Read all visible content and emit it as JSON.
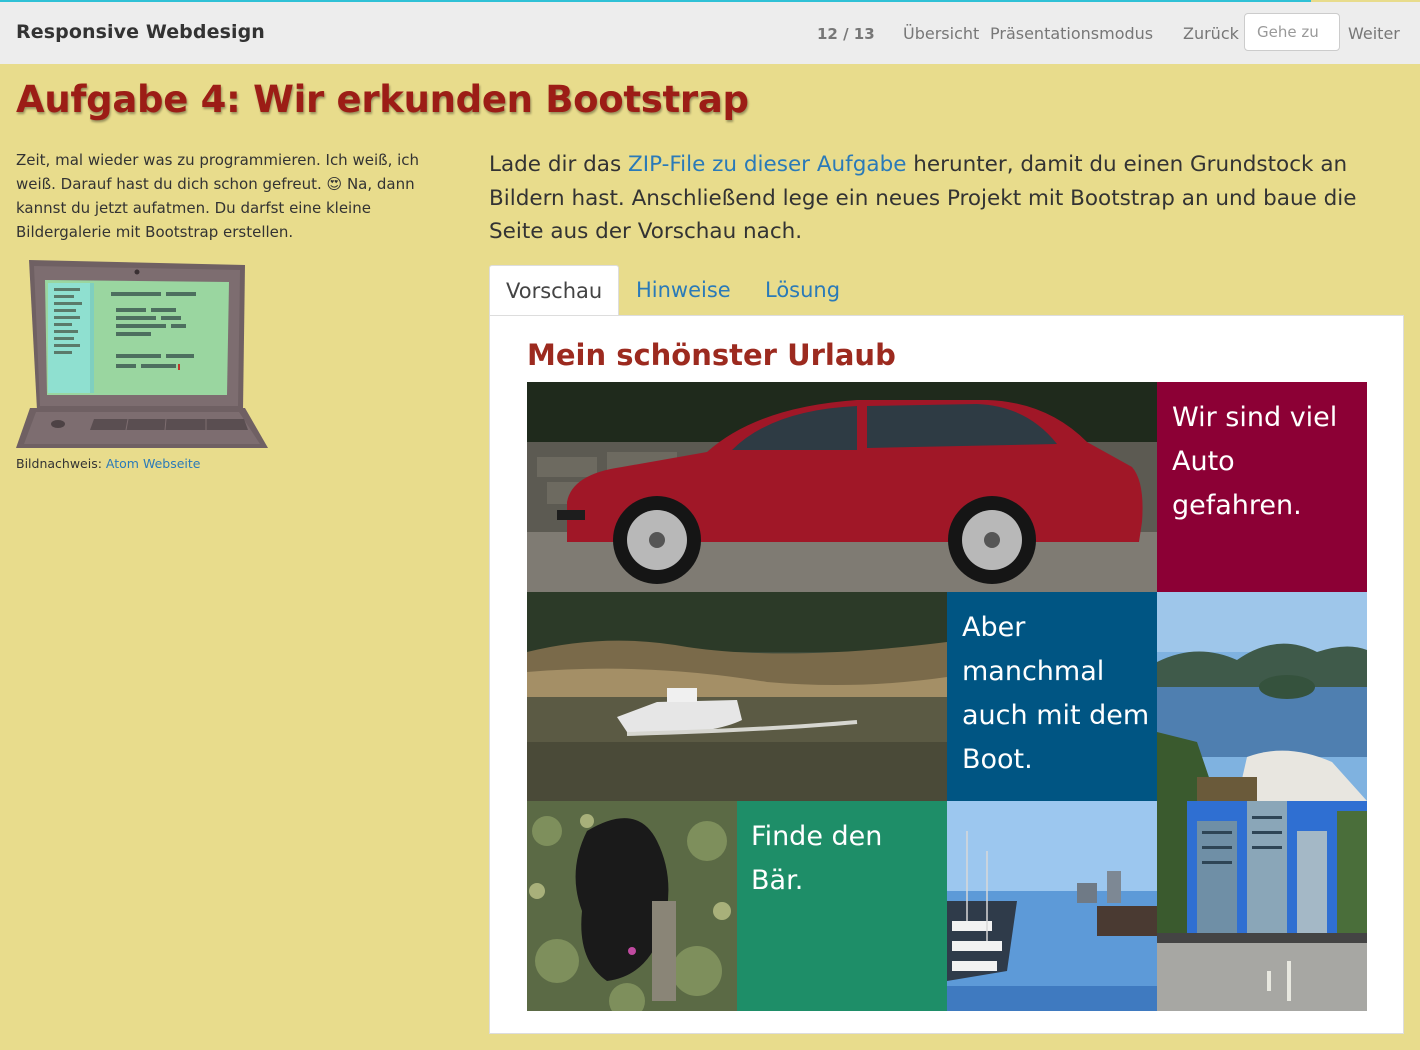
{
  "header": {
    "brand": "Responsive Webdesign",
    "page_count": "12 / 13",
    "overview_label": "Übersicht",
    "presentation_label": "Präsentationsmodus",
    "back_label": "Zurück",
    "goto_placeholder": "Gehe zu",
    "next_label": "Weiter"
  },
  "heading": "Aufgabe 4: Wir erkunden Bootstrap",
  "left": {
    "intro_before_emoji": "Zeit, mal wieder was zu programmieren. Ich weiß, ich weiß. Darauf hast du dich schon gefreut. ",
    "emoji": "😍",
    "intro_after_emoji": " Na, dann kannst du jetzt aufatmen. Du darfst eine kleine Bildergalerie mit Bootstrap erstellen.",
    "credit_label": "Bildnachweis: ",
    "credit_link": "Atom Webseite"
  },
  "lead": {
    "before_link": "Lade dir das ",
    "link_text": "ZIP-File zu dieser Aufgabe",
    "after_link": " herunter, damit du einen Grundstock an Bildern hast. Anschließend lege ein neues Projekt mit Bootstrap an und baue die Seite aus der Vorschau nach."
  },
  "tabs": [
    "Vorschau",
    "Hinweise",
    "Lösung"
  ],
  "active_tab": "Vorschau",
  "preview": {
    "title": "Mein schönster Urlaub",
    "text_car": "Wir sind viel Auto gefahren.",
    "text_boat": "Aber manchmal auch mit dem Boot.",
    "text_bear": "Finde den Bär."
  },
  "colors": {
    "page_bg": "#e8dc8c",
    "heading_red": "#9c1d16",
    "link_blue": "#2a7ab8",
    "tile_crimson": "#8c0035",
    "tile_blue": "#005583",
    "tile_green": "#1e8e68"
  },
  "icons": {
    "laptop": "laptop-illustration-icon"
  }
}
